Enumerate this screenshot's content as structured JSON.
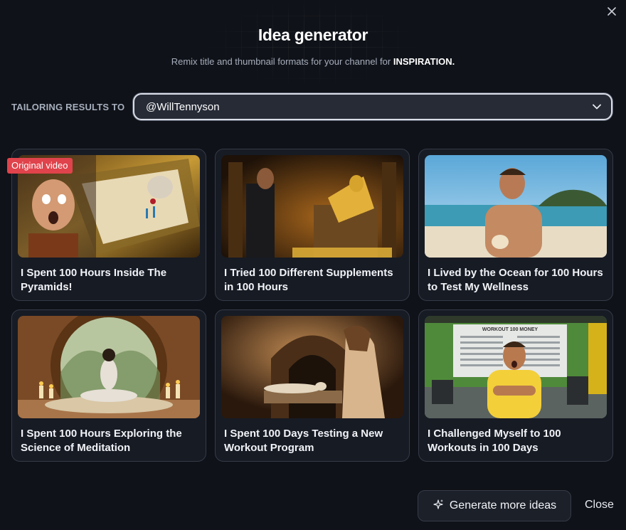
{
  "dialog": {
    "title": "Idea generator",
    "subtitle_prefix": "Remix title and thumbnail formats for your channel for",
    "subtitle_emphasis": "INSPIRATION."
  },
  "tailoring": {
    "label": "TAILORING RESULTS TO",
    "selected_channel": "@WillTennyson"
  },
  "cards": [
    {
      "title": "I Spent 100 Hours Inside The Pyramids!",
      "badge": "Original video",
      "thumbnail": "pyramid-sarcophagus-thumbnail"
    },
    {
      "title": "I Tried 100 Different Supplements in 100 Hours",
      "thumbnail": "pharaoh-throne-thumbnail"
    },
    {
      "title": "I Lived by the Ocean for 100 Hours to Test My Wellness",
      "thumbnail": "beach-man-thumbnail"
    },
    {
      "title": "I Spent 100 Hours Exploring the Science of Meditation",
      "thumbnail": "meditation-candles-thumbnail"
    },
    {
      "title": "I Spent 100 Days Testing a New Workout Program",
      "thumbnail": "stone-tunnel-thumbnail"
    },
    {
      "title": "I Challenged Myself to 100 Workouts in 100 Days",
      "thumbnail": "gym-man-thumbnail",
      "sign_text": "WORKOUT 100 MONEY"
    }
  ],
  "footer": {
    "generate_label": "Generate more ideas",
    "close_label": "Close"
  },
  "colors": {
    "background": "#0f1218",
    "card": "#171b24",
    "badge": "#e0434b",
    "select_border": "#d9dde5"
  }
}
